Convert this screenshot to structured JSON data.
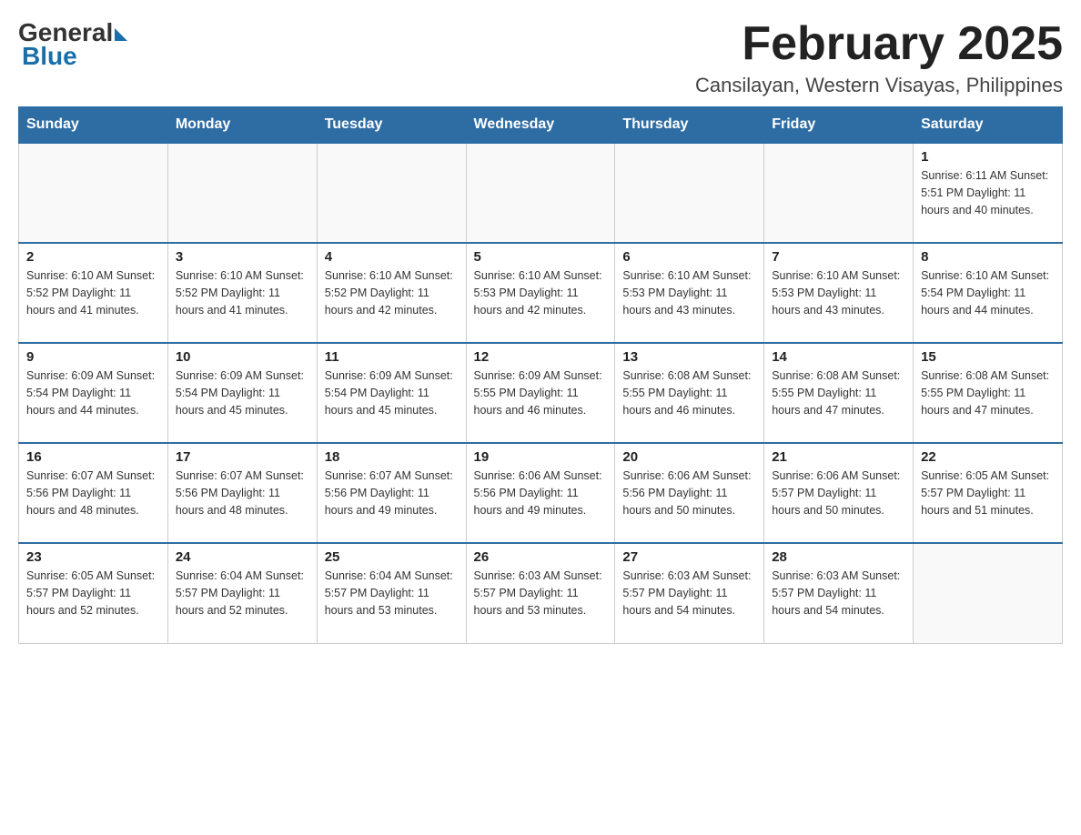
{
  "logo": {
    "general": "General",
    "blue": "Blue"
  },
  "header": {
    "month_title": "February 2025",
    "location": "Cansilayan, Western Visayas, Philippines"
  },
  "weekdays": [
    "Sunday",
    "Monday",
    "Tuesday",
    "Wednesday",
    "Thursday",
    "Friday",
    "Saturday"
  ],
  "weeks": [
    [
      {
        "day": "",
        "info": ""
      },
      {
        "day": "",
        "info": ""
      },
      {
        "day": "",
        "info": ""
      },
      {
        "day": "",
        "info": ""
      },
      {
        "day": "",
        "info": ""
      },
      {
        "day": "",
        "info": ""
      },
      {
        "day": "1",
        "info": "Sunrise: 6:11 AM\nSunset: 5:51 PM\nDaylight: 11 hours and 40 minutes."
      }
    ],
    [
      {
        "day": "2",
        "info": "Sunrise: 6:10 AM\nSunset: 5:52 PM\nDaylight: 11 hours and 41 minutes."
      },
      {
        "day": "3",
        "info": "Sunrise: 6:10 AM\nSunset: 5:52 PM\nDaylight: 11 hours and 41 minutes."
      },
      {
        "day": "4",
        "info": "Sunrise: 6:10 AM\nSunset: 5:52 PM\nDaylight: 11 hours and 42 minutes."
      },
      {
        "day": "5",
        "info": "Sunrise: 6:10 AM\nSunset: 5:53 PM\nDaylight: 11 hours and 42 minutes."
      },
      {
        "day": "6",
        "info": "Sunrise: 6:10 AM\nSunset: 5:53 PM\nDaylight: 11 hours and 43 minutes."
      },
      {
        "day": "7",
        "info": "Sunrise: 6:10 AM\nSunset: 5:53 PM\nDaylight: 11 hours and 43 minutes."
      },
      {
        "day": "8",
        "info": "Sunrise: 6:10 AM\nSunset: 5:54 PM\nDaylight: 11 hours and 44 minutes."
      }
    ],
    [
      {
        "day": "9",
        "info": "Sunrise: 6:09 AM\nSunset: 5:54 PM\nDaylight: 11 hours and 44 minutes."
      },
      {
        "day": "10",
        "info": "Sunrise: 6:09 AM\nSunset: 5:54 PM\nDaylight: 11 hours and 45 minutes."
      },
      {
        "day": "11",
        "info": "Sunrise: 6:09 AM\nSunset: 5:54 PM\nDaylight: 11 hours and 45 minutes."
      },
      {
        "day": "12",
        "info": "Sunrise: 6:09 AM\nSunset: 5:55 PM\nDaylight: 11 hours and 46 minutes."
      },
      {
        "day": "13",
        "info": "Sunrise: 6:08 AM\nSunset: 5:55 PM\nDaylight: 11 hours and 46 minutes."
      },
      {
        "day": "14",
        "info": "Sunrise: 6:08 AM\nSunset: 5:55 PM\nDaylight: 11 hours and 47 minutes."
      },
      {
        "day": "15",
        "info": "Sunrise: 6:08 AM\nSunset: 5:55 PM\nDaylight: 11 hours and 47 minutes."
      }
    ],
    [
      {
        "day": "16",
        "info": "Sunrise: 6:07 AM\nSunset: 5:56 PM\nDaylight: 11 hours and 48 minutes."
      },
      {
        "day": "17",
        "info": "Sunrise: 6:07 AM\nSunset: 5:56 PM\nDaylight: 11 hours and 48 minutes."
      },
      {
        "day": "18",
        "info": "Sunrise: 6:07 AM\nSunset: 5:56 PM\nDaylight: 11 hours and 49 minutes."
      },
      {
        "day": "19",
        "info": "Sunrise: 6:06 AM\nSunset: 5:56 PM\nDaylight: 11 hours and 49 minutes."
      },
      {
        "day": "20",
        "info": "Sunrise: 6:06 AM\nSunset: 5:56 PM\nDaylight: 11 hours and 50 minutes."
      },
      {
        "day": "21",
        "info": "Sunrise: 6:06 AM\nSunset: 5:57 PM\nDaylight: 11 hours and 50 minutes."
      },
      {
        "day": "22",
        "info": "Sunrise: 6:05 AM\nSunset: 5:57 PM\nDaylight: 11 hours and 51 minutes."
      }
    ],
    [
      {
        "day": "23",
        "info": "Sunrise: 6:05 AM\nSunset: 5:57 PM\nDaylight: 11 hours and 52 minutes."
      },
      {
        "day": "24",
        "info": "Sunrise: 6:04 AM\nSunset: 5:57 PM\nDaylight: 11 hours and 52 minutes."
      },
      {
        "day": "25",
        "info": "Sunrise: 6:04 AM\nSunset: 5:57 PM\nDaylight: 11 hours and 53 minutes."
      },
      {
        "day": "26",
        "info": "Sunrise: 6:03 AM\nSunset: 5:57 PM\nDaylight: 11 hours and 53 minutes."
      },
      {
        "day": "27",
        "info": "Sunrise: 6:03 AM\nSunset: 5:57 PM\nDaylight: 11 hours and 54 minutes."
      },
      {
        "day": "28",
        "info": "Sunrise: 6:03 AM\nSunset: 5:57 PM\nDaylight: 11 hours and 54 minutes."
      },
      {
        "day": "",
        "info": ""
      }
    ]
  ]
}
